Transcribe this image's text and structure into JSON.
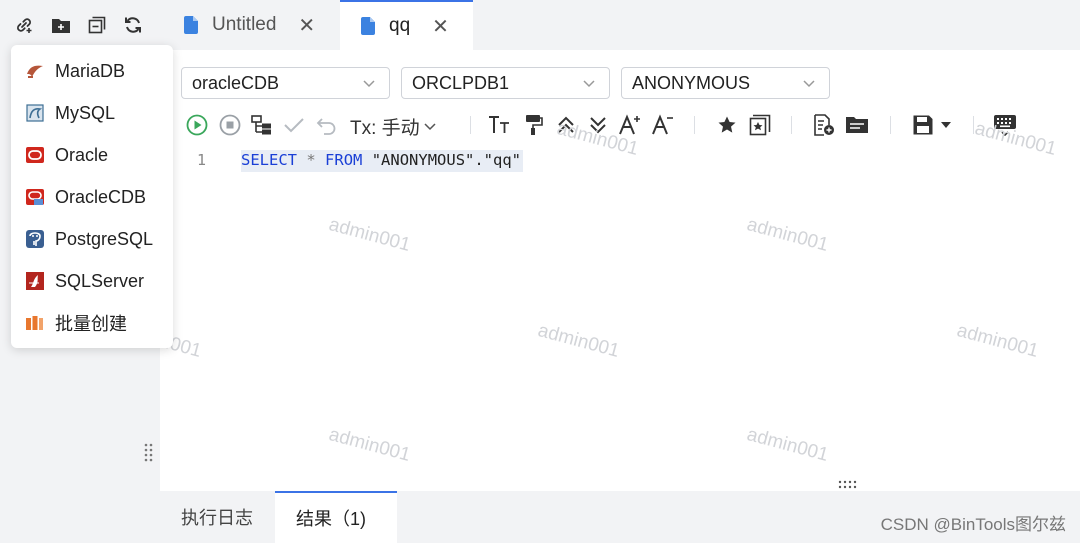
{
  "tabs": [
    {
      "title": "Untitled",
      "active": false
    },
    {
      "title": "qq",
      "active": true
    }
  ],
  "db_menu": {
    "items": [
      {
        "label": "MariaDB",
        "icon": "mariadb-icon"
      },
      {
        "label": "MySQL",
        "icon": "mysql-icon"
      },
      {
        "label": "Oracle",
        "icon": "oracle-icon"
      },
      {
        "label": "OracleCDB",
        "icon": "oraclecdb-icon"
      },
      {
        "label": "PostgreSQL",
        "icon": "postgresql-icon"
      },
      {
        "label": "SQLServer",
        "icon": "sqlserver-icon"
      },
      {
        "label": "批量创建",
        "icon": "batch-create-icon"
      }
    ]
  },
  "selects": {
    "connection": "oracleCDB",
    "database": "ORCLPDB1",
    "schema": "ANONYMOUS"
  },
  "toolbar": {
    "tx_label": "Tx: 手动"
  },
  "editor": {
    "line_number": "1",
    "tokens": {
      "select": "SELECT",
      "star": "*",
      "from": "FROM",
      "table": "\"ANONYMOUS\".\"qq\""
    }
  },
  "watermark": "admin001",
  "bottom_tabs": {
    "log": "执行日志",
    "result": "结果（1)"
  },
  "credit": "CSDN @BinTools图尔兹",
  "colors": {
    "accent": "#3b73e6",
    "keyword": "#1a3fd6",
    "run": "#3aa75b",
    "panel_bg": "#f2f3f5"
  }
}
